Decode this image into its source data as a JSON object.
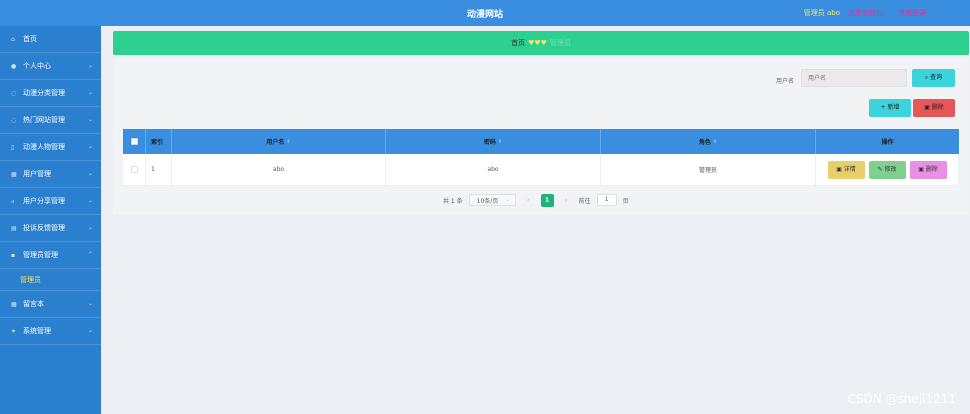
{
  "header": {
    "title": "动漫网站",
    "admin_prefix": "管理员",
    "admin_user": "abo",
    "exit_front": "退出到前台",
    "logout": "退出登录"
  },
  "sidebar": {
    "items": [
      {
        "icon": "home-icon",
        "glyph": "⌂",
        "label": "首页",
        "arrow": ""
      },
      {
        "icon": "user-icon",
        "glyph": "●",
        "label": "个人中心",
        "arrow": "⌄"
      },
      {
        "icon": "category-icon",
        "glyph": "◌",
        "label": "动漫分类管理",
        "arrow": "⌄"
      },
      {
        "icon": "tag-icon",
        "glyph": "◌",
        "label": "热门网站管理",
        "arrow": "⌄"
      },
      {
        "icon": "character-icon",
        "glyph": "▯",
        "label": "动漫人物管理",
        "arrow": "⌄"
      },
      {
        "icon": "users-icon",
        "glyph": "▦",
        "label": "用户管理",
        "arrow": "⌄"
      },
      {
        "icon": "share-icon",
        "glyph": "◃",
        "label": "用户分享管理",
        "arrow": "⌄"
      },
      {
        "icon": "database-icon",
        "glyph": "▤",
        "label": "投诉反馈管理",
        "arrow": "⌄"
      },
      {
        "icon": "grid-icon",
        "glyph": "▪",
        "label": "管理员管理",
        "arrow": "⌃"
      },
      {
        "icon": "board-icon",
        "glyph": "▦",
        "label": "留言本",
        "arrow": "⌄"
      },
      {
        "icon": "settings-icon",
        "glyph": "✦",
        "label": "系统管理",
        "arrow": "⌄"
      }
    ],
    "subitem": "管理员"
  },
  "breadcrumb": {
    "home": "首页",
    "sep": "♥♥♥",
    "current": "管理员"
  },
  "search": {
    "label": "用户名",
    "placeholder": "用户名",
    "button": "查询"
  },
  "actions": {
    "add": "+ 新增",
    "delete": "删除"
  },
  "table": {
    "columns": [
      "索引",
      "用户名",
      "密码",
      "角色",
      "操作"
    ],
    "rows": [
      {
        "index": "1",
        "username": "abo",
        "password": "abo",
        "role": "管理员"
      }
    ],
    "row_actions": {
      "detail": "详情",
      "edit": "修改",
      "delete": "删除"
    }
  },
  "pagination": {
    "total": "共 1 条",
    "page_size": "10条/页",
    "prev": "‹",
    "current": "1",
    "next": "›",
    "goto_label": "前往",
    "goto_value": "1",
    "goto_suffix": "页"
  },
  "watermark": "CSDN @sheji1211"
}
